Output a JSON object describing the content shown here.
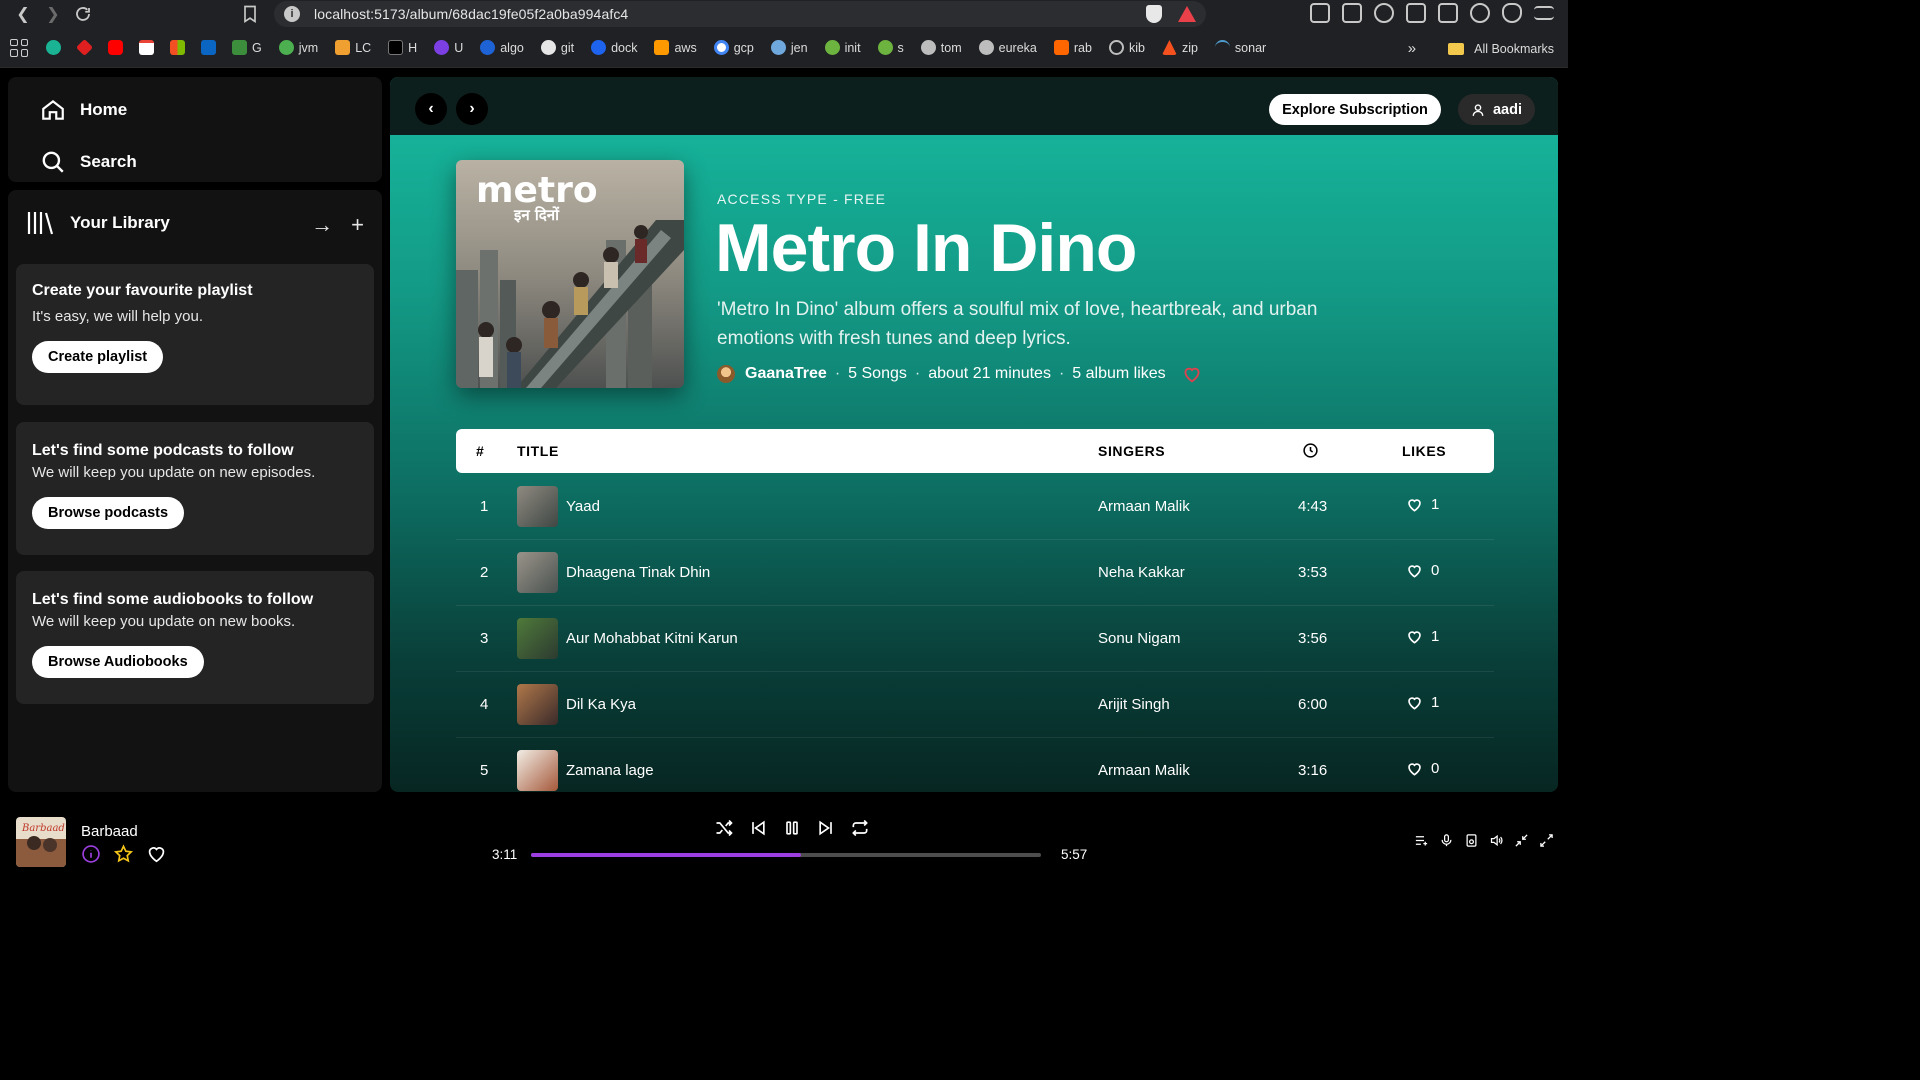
{
  "browser": {
    "url": "localhost:5173/album/68dac19fe05f2a0ba994afc4",
    "bookmarks": [
      "G",
      "jvm",
      "LC",
      "H",
      "U",
      "algo",
      "git",
      "dock",
      "aws",
      "gcp",
      "jen",
      "init",
      "s",
      "tom",
      "eureka",
      "rab",
      "kib",
      "zip",
      "sonar"
    ],
    "all_bookmarks": "All Bookmarks",
    "more": "»"
  },
  "sidebar": {
    "home": "Home",
    "search": "Search",
    "library": "Your Library",
    "cards": [
      {
        "title": "Create your favourite playlist",
        "subtitle": "It's easy, we will help you.",
        "button": "Create playlist"
      },
      {
        "title": "Let's find some podcasts to follow",
        "subtitle": "We will keep you update on new episodes.",
        "button": "Browse podcasts"
      },
      {
        "title": "Let's find some audiobooks to follow",
        "subtitle": "We will keep you update on new books.",
        "button": "Browse Audiobooks"
      }
    ]
  },
  "header": {
    "explore": "Explore Subscription",
    "user": "aadi"
  },
  "album": {
    "access": "ACCESS TYPE - FREE",
    "title": "Metro In Dino",
    "description": "'Metro In Dino' album offers a soulful mix of love, heartbreak, and urban emotions with fresh tunes and deep lyrics.",
    "artist": "GaanaTree",
    "songs": "5 Songs",
    "duration": "about 21 minutes",
    "likes": "5 album likes",
    "cover_text": "metro",
    "cover_subtext": "इन दिनों"
  },
  "table": {
    "headers": {
      "num": "#",
      "title": "TITLE",
      "singers": "SINGERS",
      "likes": "LIKES"
    },
    "rows": [
      {
        "num": "1",
        "title": "Yaad",
        "singer": "Armaan Malik",
        "duration": "4:43",
        "likes": "1"
      },
      {
        "num": "2",
        "title": "Dhaagena Tinak Dhin",
        "singer": "Neha Kakkar",
        "duration": "3:53",
        "likes": "0"
      },
      {
        "num": "3",
        "title": "Aur Mohabbat Kitni Karun",
        "singer": "Sonu Nigam",
        "duration": "3:56",
        "likes": "1"
      },
      {
        "num": "4",
        "title": "Dil Ka Kya",
        "singer": "Arijit Singh",
        "duration": "6:00",
        "likes": "1"
      },
      {
        "num": "5",
        "title": "Zamana lage",
        "singer": "Armaan Malik",
        "duration": "3:16",
        "likes": "0"
      }
    ]
  },
  "player": {
    "track": "Barbaad",
    "thumb_text": "Barbaad",
    "elapsed": "3:11",
    "total": "5:57",
    "progress": 0.53,
    "accent": "#9d3fe0"
  },
  "colors": {
    "teal_top": "#17bba0",
    "teal_dark": "#072622",
    "heart_red": "#e0414c"
  }
}
